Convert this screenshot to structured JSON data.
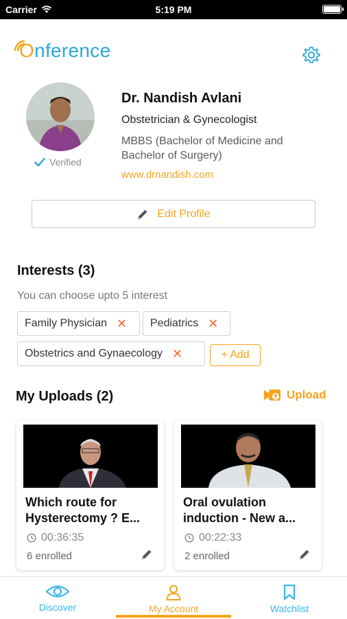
{
  "status_bar": {
    "carrier": "Carrier",
    "time": "5:19 PM"
  },
  "brand": {
    "logo_text": "Onference",
    "accent": "#29a8dd",
    "orange": "#f5a41c"
  },
  "profile": {
    "name": "Dr. Nandish Avlani",
    "specialty": "Obstetrician & Gynecologist",
    "degree": "MBBS (Bachelor of Medicine and Bachelor of Surgery)",
    "website": "www.drnandish.com",
    "verified_label": "Verified",
    "edit_label": "Edit Profile"
  },
  "interests": {
    "title": "Interests (3)",
    "hint": "You can choose upto 5 interest",
    "items": [
      "Family Physician",
      "Pediatrics",
      "Obstetrics and Gynaecology"
    ],
    "add_label": "+ Add"
  },
  "uploads": {
    "title": "My Uploads (2)",
    "upload_label": "Upload",
    "items": [
      {
        "title": "Which route for Hysterectomy ? E...",
        "duration": "00:36:35",
        "enrolled": "6 enrolled"
      },
      {
        "title": "Oral ovulation induction - New a...",
        "duration": "00:22:33",
        "enrolled": "2 enrolled"
      }
    ]
  },
  "tabs": [
    {
      "label": "Discover",
      "icon": "eye-icon"
    },
    {
      "label": "My Account",
      "icon": "user-icon",
      "active": true
    },
    {
      "label": "Watchlist",
      "icon": "bookmark-icon"
    }
  ]
}
